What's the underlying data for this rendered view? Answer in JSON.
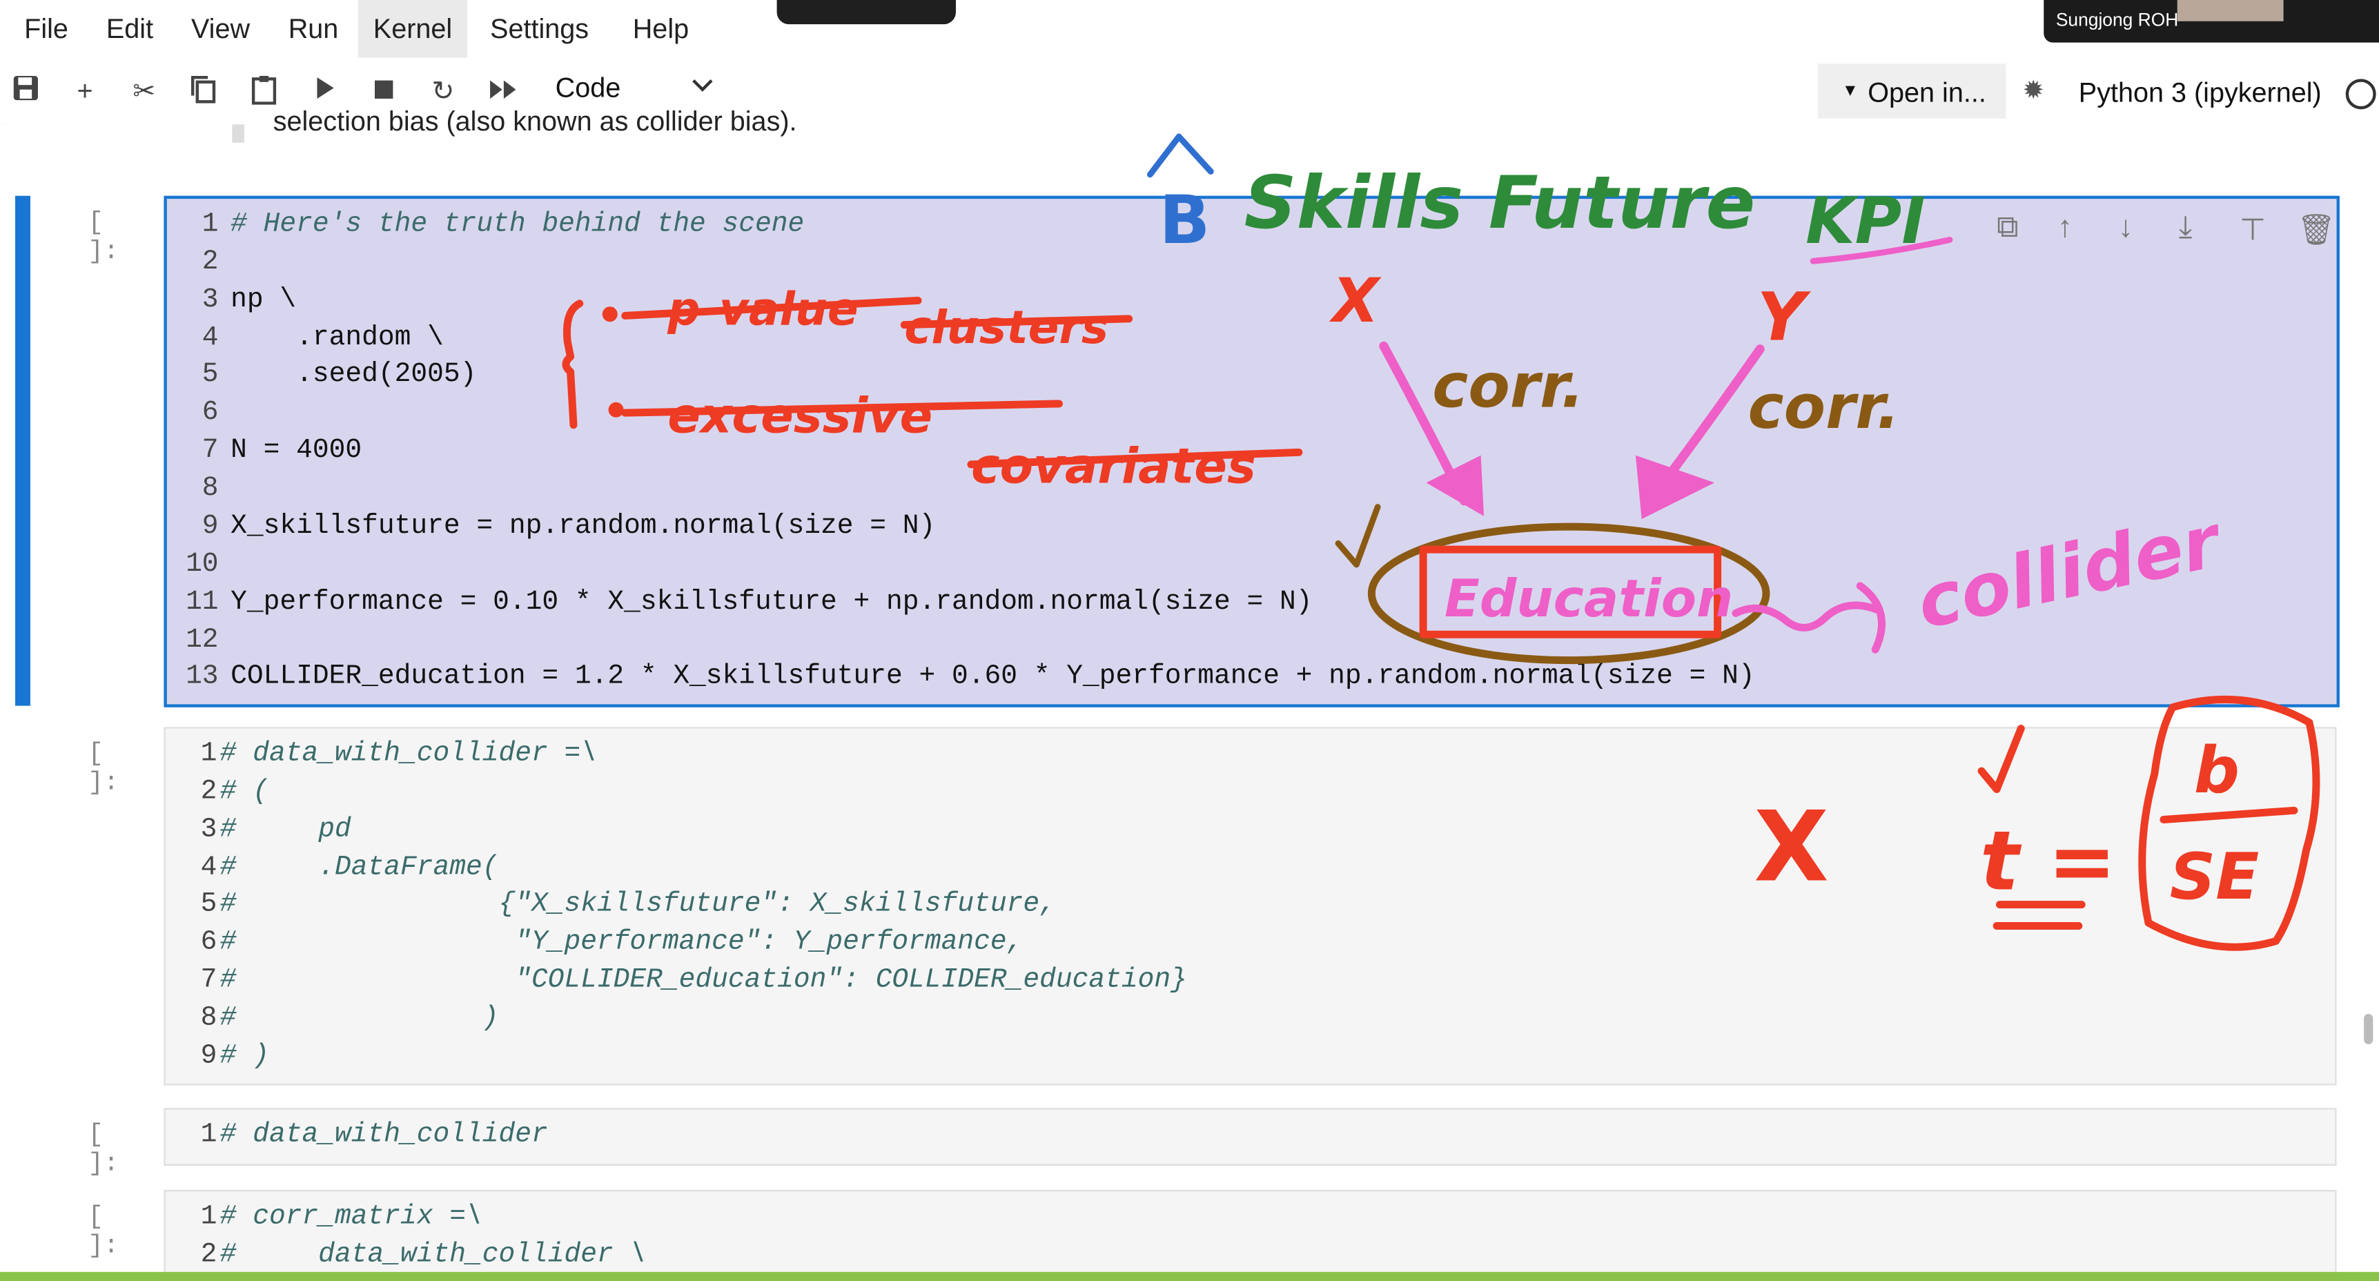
{
  "menu": {
    "file": "File",
    "edit": "Edit",
    "view": "View",
    "run": "Run",
    "kernel": "Kernel",
    "settings": "Settings",
    "help": "Help"
  },
  "video": {
    "name": "Sungjong ROH"
  },
  "toolbar": {
    "cell_type": "Code",
    "open_in": "Open in...",
    "kernel_name": "Python 3 (ipykernel)"
  },
  "notebook": {
    "prev_text": "selection bias (also known as collider bias).",
    "cells": [
      {
        "prompt": "[ ]:",
        "lines": [
          {
            "n": "1",
            "text": "# Here's the truth behind the scene"
          },
          {
            "n": "2",
            "text": ""
          },
          {
            "n": "3",
            "text": "np \\"
          },
          {
            "n": "4",
            "text": "    .random \\"
          },
          {
            "n": "5",
            "text": "    .seed(2005)"
          },
          {
            "n": "6",
            "text": ""
          },
          {
            "n": "7",
            "text": "N = 4000"
          },
          {
            "n": "8",
            "text": ""
          },
          {
            "n": "9",
            "text": "X_skillsfuture = np.random.normal(size = N)"
          },
          {
            "n": "10",
            "text": ""
          },
          {
            "n": "11",
            "text": "Y_performance = 0.10 * X_skillsfuture + np.random.normal(size = N)"
          },
          {
            "n": "12",
            "text": ""
          },
          {
            "n": "13",
            "text": "COLLIDER_education = 1.2 * X_skillsfuture + 0.60 * Y_performance + np.random.normal(size = N)"
          }
        ]
      },
      {
        "prompt": "[ ]:",
        "lines": [
          {
            "n": "1",
            "text": "# data_with_collider =\\"
          },
          {
            "n": "2",
            "text": "# ("
          },
          {
            "n": "3",
            "text": "#     pd"
          },
          {
            "n": "4",
            "text": "#     .DataFrame("
          },
          {
            "n": "5",
            "text": "#                {\"X_skillsfuture\": X_skillsfuture,"
          },
          {
            "n": "6",
            "text": "#                 \"Y_performance\": Y_performance,"
          },
          {
            "n": "7",
            "text": "#                 \"COLLIDER_education\": COLLIDER_education}"
          },
          {
            "n": "8",
            "text": "#               )"
          },
          {
            "n": "9",
            "text": "# )"
          }
        ]
      },
      {
        "prompt": "[ ]:",
        "lines": [
          {
            "n": "1",
            "text": "# data_with_collider"
          }
        ]
      },
      {
        "prompt": "[ ]:",
        "lines": [
          {
            "n": "1",
            "text": "# corr_matrix =\\"
          },
          {
            "n": "2",
            "text": "#     data_with_collider \\"
          }
        ]
      }
    ]
  },
  "annotations": {
    "skills_future": "Skills Future",
    "kpi": "KPI",
    "x_mark": "X",
    "y_mark": "Y",
    "corr_left": "corr.",
    "corr_right": "corr.",
    "p_value": "p-value",
    "clusters": "clusters",
    "excessive": "excessive",
    "covariates": "covariates",
    "education": "Education",
    "collider": "collider",
    "check": "✓",
    "big_x": "X",
    "b_letter": "b",
    "se_letter": "SE",
    "t_eq": "t =",
    "colors": {
      "red": "#ee3b24",
      "green": "#2e8b3a",
      "blue": "#2f6fd0",
      "pink": "#ee5fc8",
      "brown": "#8a5a14"
    }
  }
}
